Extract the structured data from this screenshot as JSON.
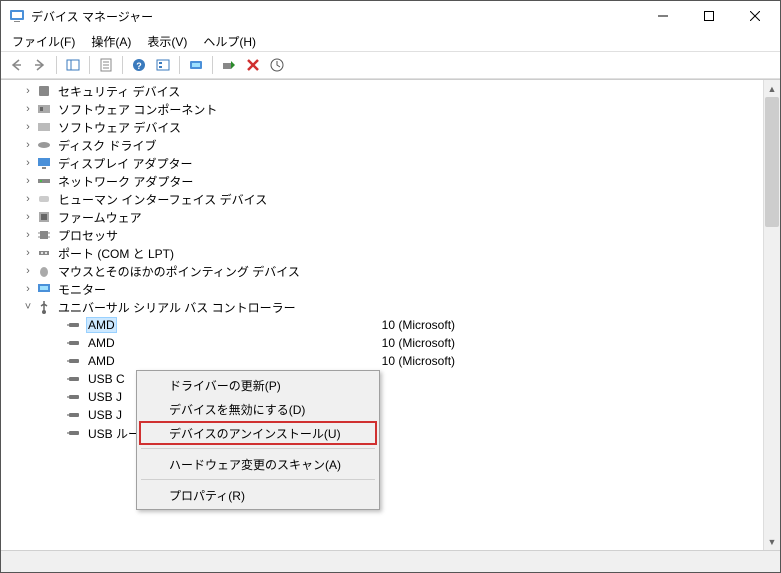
{
  "window": {
    "title": "デバイス マネージャー"
  },
  "menubar": {
    "file": "ファイル(F)",
    "action": "操作(A)",
    "view": "表示(V)",
    "help": "ヘルプ(H)"
  },
  "tree": {
    "items": [
      {
        "label": "セキュリティ デバイス",
        "iconType": "shield"
      },
      {
        "label": "ソフトウェア コンポーネント",
        "iconType": "component"
      },
      {
        "label": "ソフトウェア デバイス",
        "iconType": "device"
      },
      {
        "label": "ディスク ドライブ",
        "iconType": "disk"
      },
      {
        "label": "ディスプレイ アダプター",
        "iconType": "display"
      },
      {
        "label": "ネットワーク アダプター",
        "iconType": "network"
      },
      {
        "label": "ヒューマン インターフェイス デバイス",
        "iconType": "hid"
      },
      {
        "label": "ファームウェア",
        "iconType": "firmware"
      },
      {
        "label": "プロセッサ",
        "iconType": "cpu"
      },
      {
        "label": "ポート (COM と LPT)",
        "iconType": "port"
      },
      {
        "label": "マウスとそのほかのポインティング デバイス",
        "iconType": "mouse"
      },
      {
        "label": "モニター",
        "iconType": "monitor"
      },
      {
        "label": "ユニバーサル シリアル バス コントローラー",
        "iconType": "usb",
        "expanded": true
      }
    ],
    "usb_children": [
      {
        "label": "AMD",
        "suffix": "10 (Microsoft)",
        "selected": true
      },
      {
        "label": "AMD",
        "suffix": "10 (Microsoft)"
      },
      {
        "label": "AMD",
        "suffix": "10 (Microsoft)"
      },
      {
        "label": "USB C",
        "suffix": ""
      },
      {
        "label": "USB J",
        "suffix": ""
      },
      {
        "label": "USB J",
        "suffix": ""
      },
      {
        "label": "USB ルート ハブ (USB 3.0)",
        "suffix": ""
      }
    ]
  },
  "context_menu": {
    "items": [
      {
        "label": "ドライバーの更新(P)"
      },
      {
        "label": "デバイスを無効にする(D)"
      },
      {
        "label": "デバイスのアンインストール(U)",
        "highlight": true
      },
      {
        "sep": true
      },
      {
        "label": "ハードウェア変更のスキャン(A)"
      },
      {
        "sep": true
      },
      {
        "label": "プロパティ(R)"
      }
    ]
  }
}
